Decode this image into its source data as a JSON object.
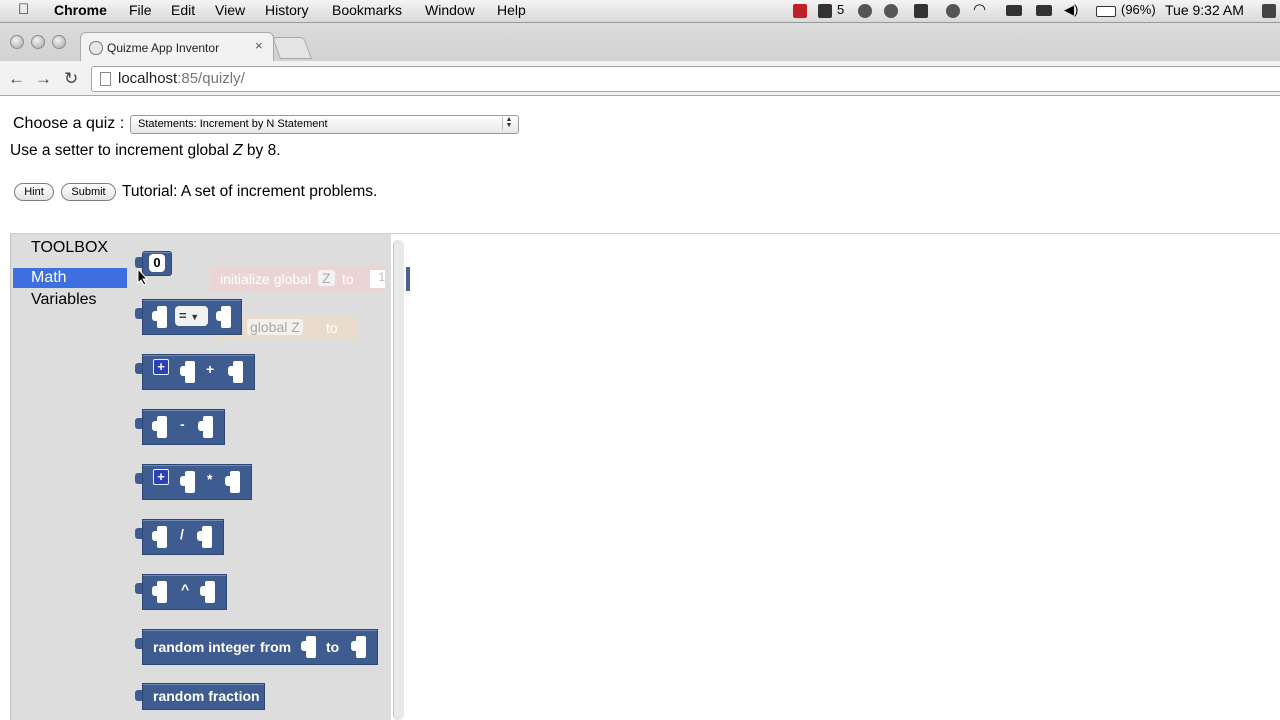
{
  "menubar": {
    "apple": "",
    "app": "Chrome",
    "items": [
      "File",
      "Edit",
      "View",
      "History",
      "Bookmarks",
      "Window",
      "Help"
    ],
    "status": {
      "adobe_count": "5",
      "battery": "(96%)",
      "clock": "Tue 9:32 AM"
    }
  },
  "browser": {
    "tab_title": "Quizme App Inventor",
    "tab_close": "×",
    "url_host": "localhost",
    "url_path": ":85/quizly/"
  },
  "page": {
    "choose_label": "Choose a quiz :",
    "quiz_selected": "Statements: Increment by N Statement",
    "instruction_prefix": "Use a setter to increment global ",
    "instruction_var": "Z",
    "instruction_suffix": " by 8.",
    "hint_label": "Hint",
    "submit_label": "Submit",
    "tutorial_text": "Tutorial: A set of increment problems."
  },
  "toolbox": {
    "title": "TOOLBOX",
    "categories": [
      "Math",
      "Variables"
    ],
    "selected": "Math"
  },
  "blocks": {
    "number_value": "0",
    "compare_op": "=",
    "add_op": "+",
    "subtract_op": "-",
    "multiply_op": "*",
    "divide_op": "/",
    "power_op": "^",
    "random_integer_label": "random integer",
    "random_from": "from",
    "random_to": "to",
    "random_fraction_label": "random fraction"
  },
  "ghosts": {
    "initialize_label": "initialize global",
    "initialize_var": "Z",
    "initialize_to": "to",
    "initialize_value": "1",
    "setter_label": "global Z",
    "setter_to": "to"
  },
  "colors": {
    "math_block": "#3e5c8f",
    "toolbox_selected": "#3d6fe0",
    "flyout_bg": "#dddddd"
  }
}
